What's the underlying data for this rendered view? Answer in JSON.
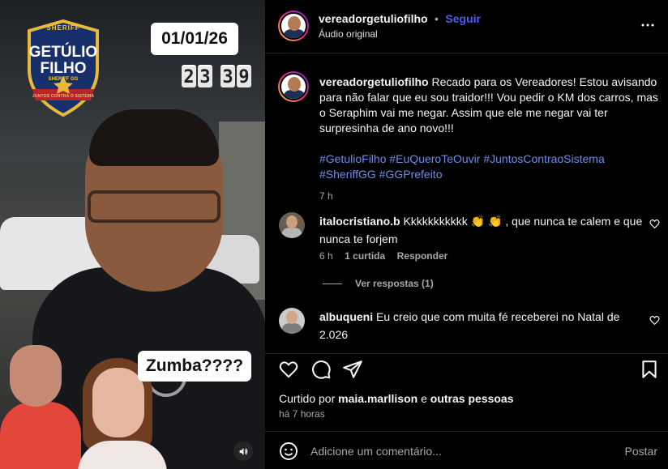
{
  "video": {
    "logo": {
      "top": "SHERIFF",
      "line1": "GETÚLIO",
      "line2": "FILHO",
      "sub": "SHERIFF GG",
      "bottom": "JUNTOS CONTRA O SISTEMA"
    },
    "date_badge": "01/01/26",
    "clock_digits": [
      "2",
      "3",
      "3",
      "9"
    ],
    "caption_badge": "Zumba????"
  },
  "post": {
    "username": "vereadorgetuliofilho",
    "separator": "•",
    "follow_label": "Seguir",
    "audio_label": "Áudio original",
    "more_icon": "more-horizontal-icon",
    "caption": {
      "username": "vereadorgetuliofilho",
      "text": "Recado para os Vereadores! Estou avisando para não falar que eu sou traidor!!! Vou pedir o KM dos carros, mas o Seraphim vai me negar. Assim que ele me negar vai ter surpresinha de ano novo!!!",
      "hashtags": [
        "#GetulioFilho",
        "#EuQueroTeOuvir",
        "#JuntosContraoSistema",
        "#SheriffGG",
        "#GGPrefeito"
      ],
      "time": "7 h"
    },
    "comments": [
      {
        "username": "italocristiano.b",
        "text": "Kkkkkkkkkkk 👏 👏 , que nunca te calem e que nunca te forjem",
        "time": "6 h",
        "likes": "1 curtida",
        "reply_label": "Responder",
        "view_replies": "Ver respostas (1)"
      },
      {
        "username": "albuqueni",
        "text": "Eu creio que com muita fé receberei no Natal de 2.026"
      }
    ],
    "liked_by_prefix": "Curtido por",
    "liked_by_user": "maia.marllison",
    "liked_by_conj": "e",
    "liked_by_rest": "outras pessoas",
    "time_ago": "há 7 horas",
    "add_comment_placeholder": "Adicione um comentário...",
    "post_button": "Postar"
  },
  "colors": {
    "background": "#000000",
    "follow_blue": "#4a5df9",
    "hashtag_blue": "#6c8ee8",
    "muted_text": "#a8a8a8",
    "divider": "#262626"
  }
}
